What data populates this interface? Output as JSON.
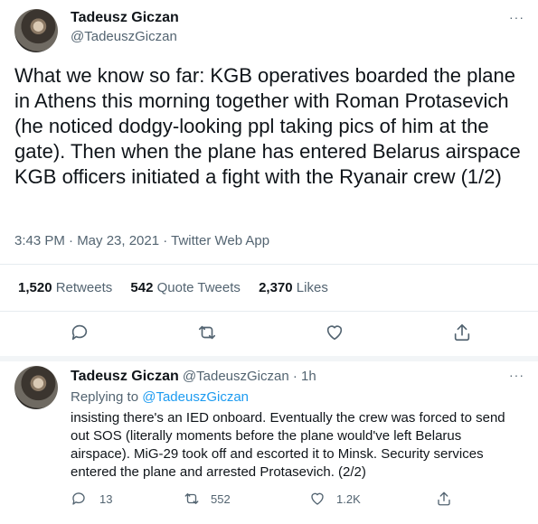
{
  "tweet": {
    "author_name": "Tadeusz Giczan",
    "author_handle": "@TadeuszGiczan",
    "text": "What we know so far: KGB operatives boarded the plane in Athens this morning together with Roman Protasevich (he noticed dodgy-looking ppl taking pics of him at the gate). Then when the plane has entered Belarus airspace KGB officers initiated a fight with the Ryanair crew (1/2)",
    "meta": "3:43 PM · May 23, 2021 · Twitter Web App",
    "more_label": "···",
    "stats": {
      "retweets_count": "1,520",
      "retweets_label": "Retweets",
      "quote_count": "542",
      "quote_label": "Quote Tweets",
      "likes_count": "2,370",
      "likes_label": "Likes"
    },
    "actions": [
      "reply-icon",
      "retweet-icon",
      "like-icon",
      "share-icon"
    ]
  },
  "reply": {
    "author_name": "Tadeusz Giczan",
    "author_handle": "@TadeuszGiczan",
    "time": "· 1h",
    "replying_prefix": "Replying to",
    "replying_handle": "@TadeuszGiczan",
    "text": "insisting there's an IED onboard. Eventually the crew was forced to send out SOS (literally moments before the plane would've left Belarus airspace). MiG-29 took off and escorted it to Minsk. Security services entered the plane and arrested Protasevich. (2/2)",
    "more_label": "···",
    "counts": {
      "replies": "13",
      "retweets": "552",
      "likes": "1.2K"
    }
  },
  "colors": {
    "text": "#0f1419",
    "muted": "#536471",
    "link": "#1d9bf0",
    "divider": "#e6ecf0"
  }
}
